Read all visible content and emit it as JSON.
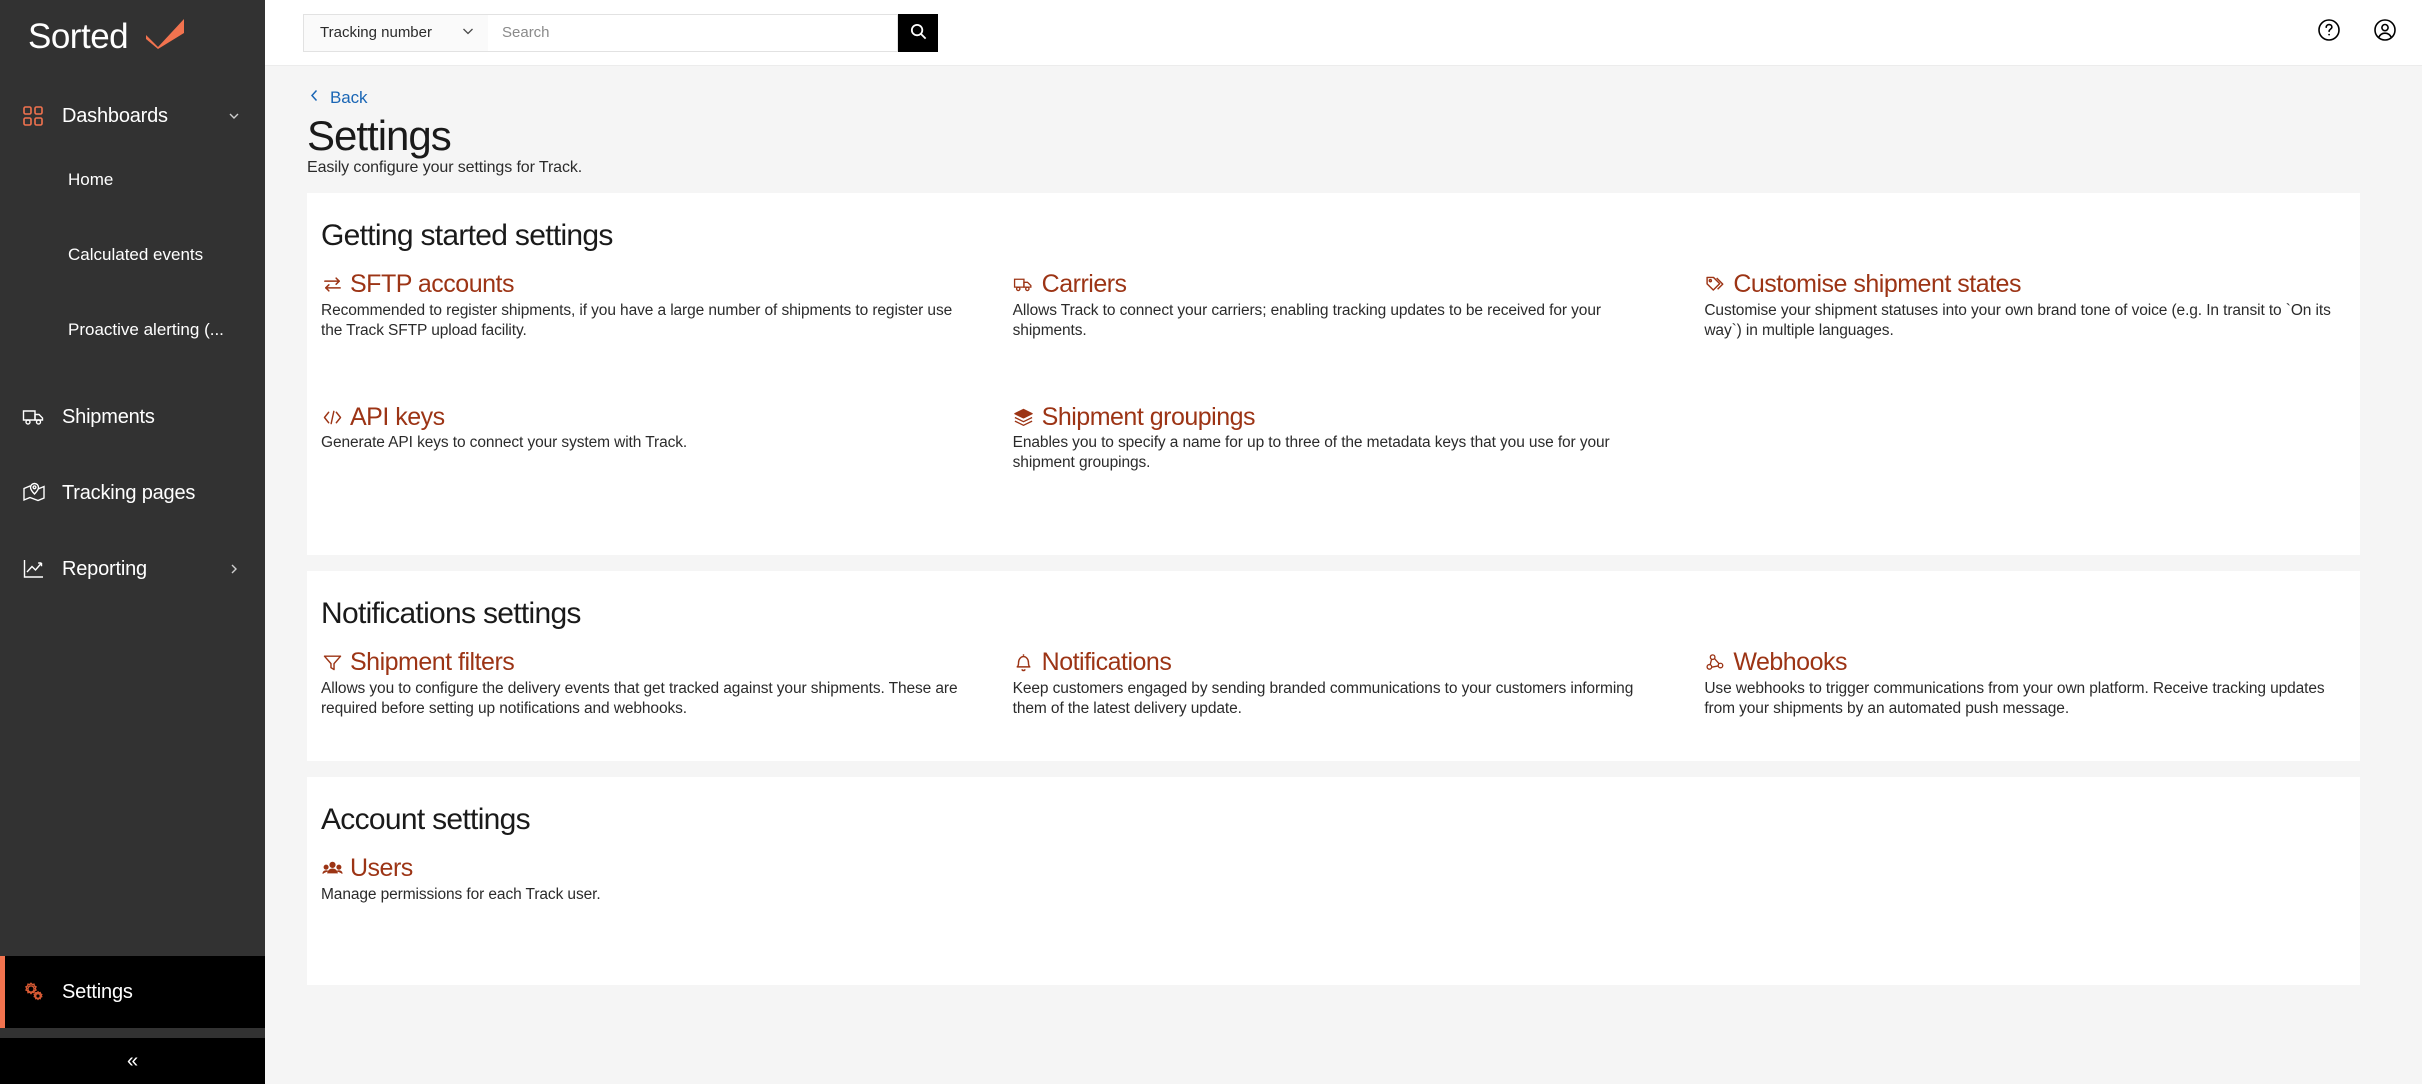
{
  "brand": {
    "name": "Sorted",
    "mark": "checkmark-logo",
    "accent": "#f2734f"
  },
  "sidebar": {
    "items": [
      {
        "label": "Dashboards",
        "icon": "grid-icon",
        "chevron": "chevron-down-icon"
      },
      {
        "label": "Shipments",
        "icon": "truck-icon"
      },
      {
        "label": "Tracking pages",
        "icon": "map-pin-icon"
      },
      {
        "label": "Reporting",
        "icon": "chart-line-icon",
        "chevron": "chevron-right-icon"
      }
    ],
    "dashboard_children": [
      {
        "label": "Home"
      },
      {
        "label": "Calculated events"
      },
      {
        "label": "Proactive alerting (..."
      }
    ],
    "settings": {
      "label": "Settings",
      "icon": "gears-icon",
      "active": true
    },
    "collapse": {
      "label": "«",
      "name": "collapse-sidebar"
    }
  },
  "topbar": {
    "search_scope": "Tracking number",
    "search_scope_icon": "chevron-down-icon",
    "search_placeholder": "Search",
    "search_value": "",
    "search_button_icon": "search-icon",
    "help_icon": "help-circle-icon",
    "account_icon": "user-circle-icon"
  },
  "header": {
    "back_label": "Back",
    "back_icon": "chevron-left-icon",
    "title": "Settings",
    "subtitle": "Easily configure your settings for Track."
  },
  "sections": [
    {
      "title": "Getting started settings",
      "tiles": [
        {
          "title": "SFTP accounts",
          "icon": "transfer-arrows-icon",
          "desc": "Recommended to register shipments, if you have a large number of shipments to register use the Track SFTP upload facility."
        },
        {
          "title": "Carriers",
          "icon": "truck-icon",
          "desc": "Allows Track to connect your carriers; enabling tracking updates to be received for your shipments."
        },
        {
          "title": "Customise shipment states",
          "icon": "tags-icon",
          "desc": "Customise your shipment statuses into your own brand tone of voice (e.g. In transit to `On its way`) in multiple languages."
        },
        {
          "title": "API keys",
          "icon": "code-brackets-icon",
          "desc": "Generate API keys to connect your system with Track."
        },
        {
          "title": "Shipment groupings",
          "icon": "layers-icon",
          "desc": "Enables you to specify a name for up to three of the metadata keys that you use for your shipment groupings."
        },
        {
          "title": "",
          "icon": "",
          "desc": ""
        }
      ]
    },
    {
      "title": "Notifications settings",
      "tiles": [
        {
          "title": "Shipment filters",
          "icon": "filter-funnel-icon",
          "desc": "Allows you to configure the delivery events that get tracked against your shipments. These are required before setting up notifications and webhooks."
        },
        {
          "title": "Notifications",
          "icon": "bell-icon",
          "desc": "Keep customers engaged by sending branded communications to your customers informing them of the latest delivery update."
        },
        {
          "title": "Webhooks",
          "icon": "webhook-icon",
          "desc": "Use webhooks to trigger communications from your own platform. Receive tracking updates from your shipments by an automated push message."
        }
      ]
    },
    {
      "title": "Account settings",
      "tiles": [
        {
          "title": "Users",
          "icon": "users-group-icon",
          "desc": "Manage permissions for each Track user."
        }
      ]
    }
  ],
  "colors": {
    "tile_link": "#9c3415",
    "back_link": "#1a66b5",
    "sidebar_bg": "#323232",
    "page_bg": "#f5f5f5"
  }
}
